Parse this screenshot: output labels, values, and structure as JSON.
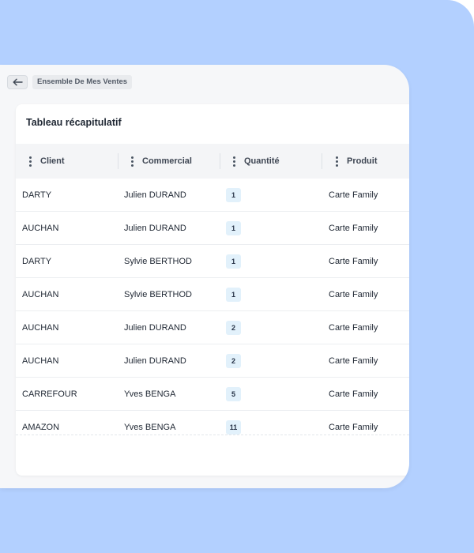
{
  "breadcrumb": {
    "label": "Ensemble De Mes Ventes"
  },
  "card": {
    "title": "Tableau récapitulatif"
  },
  "table": {
    "columns": [
      "Client",
      "Commercial",
      "Quantité",
      "Produit"
    ],
    "rows": [
      {
        "client": "DARTY",
        "commercial": "Julien DURAND",
        "quantite": "1",
        "produit": "Carte Family"
      },
      {
        "client": "AUCHAN",
        "commercial": "Julien DURAND",
        "quantite": "1",
        "produit": "Carte Family"
      },
      {
        "client": "DARTY",
        "commercial": "Sylvie BERTHOD",
        "quantite": "1",
        "produit": "Carte Family"
      },
      {
        "client": "AUCHAN",
        "commercial": "Sylvie BERTHOD",
        "quantite": "1",
        "produit": "Carte Family"
      },
      {
        "client": "AUCHAN",
        "commercial": "Julien DURAND",
        "quantite": "2",
        "produit": "Carte Family"
      },
      {
        "client": "AUCHAN",
        "commercial": "Julien DURAND",
        "quantite": "2",
        "produit": "Carte Family"
      },
      {
        "client": "CARREFOUR",
        "commercial": "Yves BENGA",
        "quantite": "5",
        "produit": "Carte Family"
      },
      {
        "client": "AMAZON",
        "commercial": "Yves BENGA",
        "quantite": "11",
        "produit": "Carte Family"
      }
    ]
  },
  "icons": {
    "back": "arrow-left-icon",
    "column_menu": "kebab-menu-icon"
  },
  "colors": {
    "background": "#b3d0ff",
    "badge": "#e2f1fb"
  }
}
